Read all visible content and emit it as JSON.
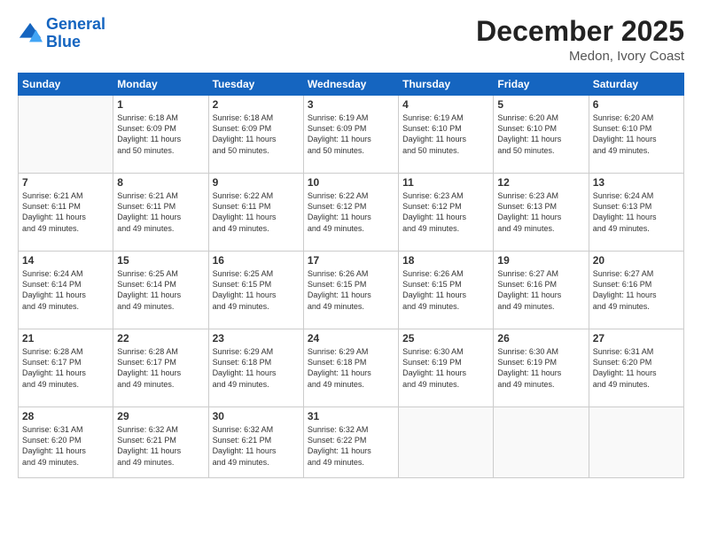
{
  "header": {
    "logo_line1": "General",
    "logo_line2": "Blue",
    "main_title": "December 2025",
    "subtitle": "Medon, Ivory Coast"
  },
  "days_of_week": [
    "Sunday",
    "Monday",
    "Tuesday",
    "Wednesday",
    "Thursday",
    "Friday",
    "Saturday"
  ],
  "weeks": [
    [
      {
        "day": "",
        "info": ""
      },
      {
        "day": "1",
        "info": "Sunrise: 6:18 AM\nSunset: 6:09 PM\nDaylight: 11 hours\nand 50 minutes."
      },
      {
        "day": "2",
        "info": "Sunrise: 6:18 AM\nSunset: 6:09 PM\nDaylight: 11 hours\nand 50 minutes."
      },
      {
        "day": "3",
        "info": "Sunrise: 6:19 AM\nSunset: 6:09 PM\nDaylight: 11 hours\nand 50 minutes."
      },
      {
        "day": "4",
        "info": "Sunrise: 6:19 AM\nSunset: 6:10 PM\nDaylight: 11 hours\nand 50 minutes."
      },
      {
        "day": "5",
        "info": "Sunrise: 6:20 AM\nSunset: 6:10 PM\nDaylight: 11 hours\nand 50 minutes."
      },
      {
        "day": "6",
        "info": "Sunrise: 6:20 AM\nSunset: 6:10 PM\nDaylight: 11 hours\nand 49 minutes."
      }
    ],
    [
      {
        "day": "7",
        "info": "Sunrise: 6:21 AM\nSunset: 6:11 PM\nDaylight: 11 hours\nand 49 minutes."
      },
      {
        "day": "8",
        "info": "Sunrise: 6:21 AM\nSunset: 6:11 PM\nDaylight: 11 hours\nand 49 minutes."
      },
      {
        "day": "9",
        "info": "Sunrise: 6:22 AM\nSunset: 6:11 PM\nDaylight: 11 hours\nand 49 minutes."
      },
      {
        "day": "10",
        "info": "Sunrise: 6:22 AM\nSunset: 6:12 PM\nDaylight: 11 hours\nand 49 minutes."
      },
      {
        "day": "11",
        "info": "Sunrise: 6:23 AM\nSunset: 6:12 PM\nDaylight: 11 hours\nand 49 minutes."
      },
      {
        "day": "12",
        "info": "Sunrise: 6:23 AM\nSunset: 6:13 PM\nDaylight: 11 hours\nand 49 minutes."
      },
      {
        "day": "13",
        "info": "Sunrise: 6:24 AM\nSunset: 6:13 PM\nDaylight: 11 hours\nand 49 minutes."
      }
    ],
    [
      {
        "day": "14",
        "info": "Sunrise: 6:24 AM\nSunset: 6:14 PM\nDaylight: 11 hours\nand 49 minutes."
      },
      {
        "day": "15",
        "info": "Sunrise: 6:25 AM\nSunset: 6:14 PM\nDaylight: 11 hours\nand 49 minutes."
      },
      {
        "day": "16",
        "info": "Sunrise: 6:25 AM\nSunset: 6:15 PM\nDaylight: 11 hours\nand 49 minutes."
      },
      {
        "day": "17",
        "info": "Sunrise: 6:26 AM\nSunset: 6:15 PM\nDaylight: 11 hours\nand 49 minutes."
      },
      {
        "day": "18",
        "info": "Sunrise: 6:26 AM\nSunset: 6:15 PM\nDaylight: 11 hours\nand 49 minutes."
      },
      {
        "day": "19",
        "info": "Sunrise: 6:27 AM\nSunset: 6:16 PM\nDaylight: 11 hours\nand 49 minutes."
      },
      {
        "day": "20",
        "info": "Sunrise: 6:27 AM\nSunset: 6:16 PM\nDaylight: 11 hours\nand 49 minutes."
      }
    ],
    [
      {
        "day": "21",
        "info": "Sunrise: 6:28 AM\nSunset: 6:17 PM\nDaylight: 11 hours\nand 49 minutes."
      },
      {
        "day": "22",
        "info": "Sunrise: 6:28 AM\nSunset: 6:17 PM\nDaylight: 11 hours\nand 49 minutes."
      },
      {
        "day": "23",
        "info": "Sunrise: 6:29 AM\nSunset: 6:18 PM\nDaylight: 11 hours\nand 49 minutes."
      },
      {
        "day": "24",
        "info": "Sunrise: 6:29 AM\nSunset: 6:18 PM\nDaylight: 11 hours\nand 49 minutes."
      },
      {
        "day": "25",
        "info": "Sunrise: 6:30 AM\nSunset: 6:19 PM\nDaylight: 11 hours\nand 49 minutes."
      },
      {
        "day": "26",
        "info": "Sunrise: 6:30 AM\nSunset: 6:19 PM\nDaylight: 11 hours\nand 49 minutes."
      },
      {
        "day": "27",
        "info": "Sunrise: 6:31 AM\nSunset: 6:20 PM\nDaylight: 11 hours\nand 49 minutes."
      }
    ],
    [
      {
        "day": "28",
        "info": "Sunrise: 6:31 AM\nSunset: 6:20 PM\nDaylight: 11 hours\nand 49 minutes."
      },
      {
        "day": "29",
        "info": "Sunrise: 6:32 AM\nSunset: 6:21 PM\nDaylight: 11 hours\nand 49 minutes."
      },
      {
        "day": "30",
        "info": "Sunrise: 6:32 AM\nSunset: 6:21 PM\nDaylight: 11 hours\nand 49 minutes."
      },
      {
        "day": "31",
        "info": "Sunrise: 6:32 AM\nSunset: 6:22 PM\nDaylight: 11 hours\nand 49 minutes."
      },
      {
        "day": "",
        "info": ""
      },
      {
        "day": "",
        "info": ""
      },
      {
        "day": "",
        "info": ""
      }
    ]
  ]
}
